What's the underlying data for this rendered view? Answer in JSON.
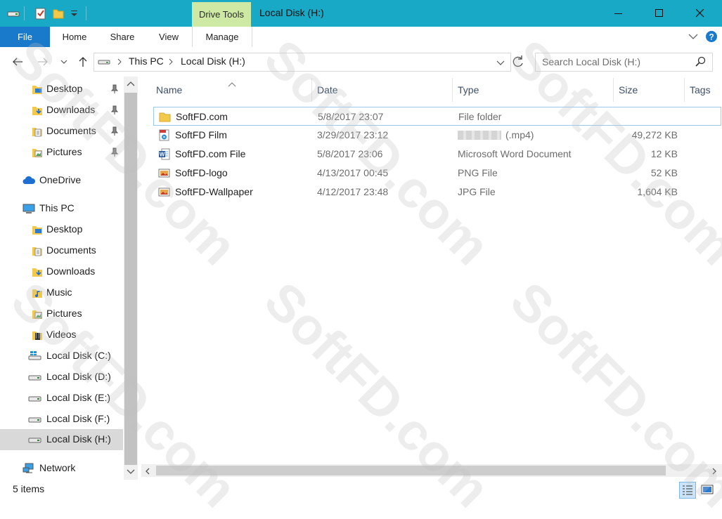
{
  "window": {
    "title": "Local Disk (H:)",
    "context_tab": "Drive Tools",
    "minimize_icon": "minimize-icon",
    "maximize_icon": "maximize-icon",
    "close_icon": "close-icon"
  },
  "ribbon": {
    "tabs": [
      "File",
      "Home",
      "Share",
      "View",
      "Manage"
    ]
  },
  "address": {
    "crumbs": [
      "This PC",
      "Local Disk (H:)"
    ],
    "search_placeholder": "Search Local Disk (H:)"
  },
  "nav": {
    "quick_access": [
      {
        "label": "Desktop",
        "icon": "desktop-folder-icon",
        "pinned": true
      },
      {
        "label": "Downloads",
        "icon": "downloads-folder-icon",
        "pinned": true
      },
      {
        "label": "Documents",
        "icon": "documents-folder-icon",
        "pinned": true
      },
      {
        "label": "Pictures",
        "icon": "pictures-folder-icon",
        "pinned": true
      }
    ],
    "onedrive": "OneDrive",
    "this_pc": "This PC",
    "pc_items": [
      {
        "label": "Desktop",
        "icon": "desktop-folder-icon"
      },
      {
        "label": "Documents",
        "icon": "documents-folder-icon"
      },
      {
        "label": "Downloads",
        "icon": "downloads-folder-icon"
      },
      {
        "label": "Music",
        "icon": "music-folder-icon"
      },
      {
        "label": "Pictures",
        "icon": "pictures-folder-icon"
      },
      {
        "label": "Videos",
        "icon": "videos-folder-icon"
      },
      {
        "label": "Local Disk (C:)",
        "icon": "windows-drive-icon"
      },
      {
        "label": "Local Disk (D:)",
        "icon": "drive-icon"
      },
      {
        "label": "Local Disk (E:)",
        "icon": "drive-icon"
      },
      {
        "label": "Local Disk (F:)",
        "icon": "drive-icon"
      },
      {
        "label": "Local Disk (H:)",
        "icon": "drive-icon",
        "selected": true
      }
    ],
    "network": "Network"
  },
  "columns": [
    "Name",
    "Date",
    "Type",
    "Size",
    "Tags"
  ],
  "files": [
    {
      "name": "SoftFD.com",
      "date": "5/8/2017 23:07",
      "type": "File folder",
      "size": "",
      "icon": "folder-icon"
    },
    {
      "name": "SoftFD Film",
      "date": "3/29/2017 23:12",
      "type": "(.mp4)",
      "size": "49,272 KB",
      "icon": "video-file-icon"
    },
    {
      "name": "SoftFD.com File",
      "date": "5/8/2017 23:06",
      "type": "Microsoft Word Document",
      "size": "12 KB",
      "icon": "word-document-icon"
    },
    {
      "name": "SoftFD-logo",
      "date": "4/13/2017 00:45",
      "type": "PNG File",
      "size": "52 KB",
      "icon": "image-file-icon"
    },
    {
      "name": "SoftFD-Wallpaper",
      "date": "4/12/2017 23:48",
      "type": "JPG File",
      "size": "1,604 KB",
      "icon": "image-file-icon"
    }
  ],
  "status": {
    "count": "5 items"
  },
  "watermark": "SoftFD.com",
  "colors": {
    "titlebar": "#17a9c6",
    "file_tab": "#1979ca",
    "context_tab": "#cde9a3",
    "selection": "#d9d9d9"
  }
}
